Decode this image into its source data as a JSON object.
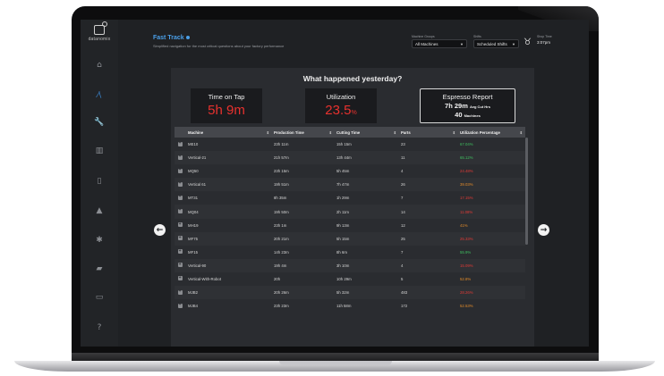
{
  "sidebar": {
    "logo_text": "datanomix",
    "items": [
      {
        "icon": "home-icon",
        "glyph": "⌂",
        "active": false
      },
      {
        "icon": "trend-icon",
        "glyph": "⁄\\",
        "active": true
      },
      {
        "icon": "wrench-icon",
        "glyph": "🔧",
        "active": false
      },
      {
        "icon": "bar-chart-icon",
        "glyph": "▥",
        "active": false
      },
      {
        "icon": "trash-icon",
        "glyph": "▯",
        "active": false
      },
      {
        "icon": "warning-icon",
        "glyph": "▲",
        "active": false
      },
      {
        "icon": "gear-icon",
        "glyph": "✱",
        "active": false
      },
      {
        "icon": "factory-icon",
        "glyph": "▰",
        "active": false
      },
      {
        "icon": "monitor-icon",
        "glyph": "▭",
        "active": false
      },
      {
        "icon": "help-icon",
        "glyph": "?",
        "active": false
      }
    ]
  },
  "header": {
    "title": "Fast Track",
    "subtitle": "Simplified navigation for the most critical questions about your factory performance",
    "machine_groups_label": "Machine Groups",
    "machine_groups_value": "All Machines",
    "shifts_label": "Shifts",
    "shifts_value": "Scheduled Shifts",
    "shift_time_label": "Shop Time",
    "shift_time_value": "3:07pm"
  },
  "panel": {
    "title": "What happened yesterday?",
    "kpis": {
      "time_on_tap_label": "Time on Tap",
      "time_on_tap_value": "5h 9m",
      "utilization_label": "Utilization",
      "utilization_value": "23.5",
      "utilization_unit": "%",
      "espresso_label": "Espresso Report",
      "espresso_time": "7h 29m",
      "espresso_time_unit": "Avg Cut Hrs",
      "espresso_machines": "40",
      "espresso_machines_unit": "Machines"
    }
  },
  "table": {
    "columns": [
      "Machine",
      "Production Time",
      "Cutting Time",
      "Parts",
      "Utilization Percentage"
    ],
    "rows": [
      {
        "machine": "ME10",
        "production": "23h 11m",
        "cutting": "15h 15m",
        "parts": "23",
        "util": "67.04%",
        "color": "#3fbf5f"
      },
      {
        "machine": "Vertical-21",
        "production": "21h 57m",
        "cutting": "13h 44m",
        "parts": "11",
        "util": "65.12%",
        "color": "#3fbf5f"
      },
      {
        "machine": "MQ50",
        "production": "23h 15m",
        "cutting": "5h 45m",
        "parts": "4",
        "util": "24.48%",
        "color": "#e03a36"
      },
      {
        "machine": "Vertical 61",
        "production": "19h 51m",
        "cutting": "7h 47m",
        "parts": "26",
        "util": "39.03%",
        "color": "#e08a2a"
      },
      {
        "machine": "MT31",
        "production": "8h 35m",
        "cutting": "1h 29m",
        "parts": "7",
        "util": "17.15%",
        "color": "#e03a36"
      },
      {
        "machine": "MQ04",
        "production": "19h 50m",
        "cutting": "2h 11m",
        "parts": "14",
        "util": "11.08%",
        "color": "#e03a36"
      },
      {
        "machine": "MH19",
        "production": "23h 1m",
        "cutting": "9h 13m",
        "parts": "12",
        "util": "41%",
        "color": "#e08a2a"
      },
      {
        "machine": "MF75",
        "production": "20h 21m",
        "cutting": "5h 15m",
        "parts": "25",
        "util": "25.33%",
        "color": "#e03a36"
      },
      {
        "machine": "MF15",
        "production": "14h 23m",
        "cutting": "8h 6m",
        "parts": "7",
        "util": "55.9%",
        "color": "#3fbf5f"
      },
      {
        "machine": "Vertical-90",
        "production": "19h 4m",
        "cutting": "3h 10m",
        "parts": "4",
        "util": "15.09%",
        "color": "#e03a36"
      },
      {
        "machine": "Vertical-With-Robot",
        "production": "20h",
        "cutting": "10h 29m",
        "parts": "5",
        "util": "52.8%",
        "color": "#e08a2a"
      },
      {
        "machine": "MJB2",
        "production": "20h 26m",
        "cutting": "5h 32m",
        "parts": "483",
        "util": "28.26%",
        "color": "#e03a36"
      },
      {
        "machine": "MJB4",
        "production": "23h 23m",
        "cutting": "11h 58m",
        "parts": "172",
        "util": "52.53%",
        "color": "#e08a2a"
      }
    ]
  }
}
